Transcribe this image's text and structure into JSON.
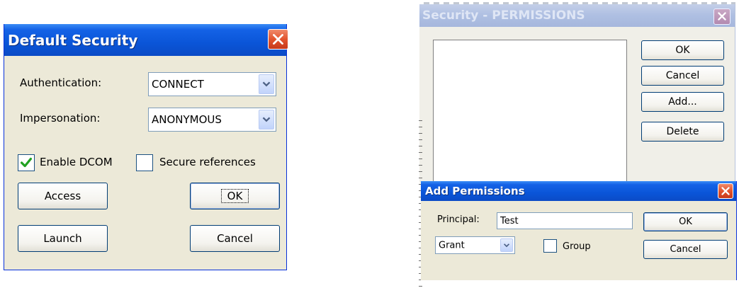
{
  "default_security": {
    "title": "Default Security",
    "authentication_label": "Authentication:",
    "authentication_value": "CONNECT",
    "impersonation_label": "Impersonation:",
    "impersonation_value": "ANONYMOUS",
    "enable_dcom_label": "Enable DCOM",
    "enable_dcom_checked": true,
    "secure_references_label": "Secure references",
    "secure_references_checked": false,
    "access_label": "Access",
    "ok_label": "OK",
    "launch_label": "Launch",
    "cancel_label": "Cancel"
  },
  "security_permissions": {
    "title": "Security - PERMISSIONS",
    "ok_label": "OK",
    "cancel_label": "Cancel",
    "add_label": "Add...",
    "delete_label": "Delete",
    "list_items": []
  },
  "add_permissions": {
    "title": "Add Permissions",
    "principal_label": "Principal:",
    "principal_value": "Test",
    "grant_value": "Grant",
    "group_label": "Group",
    "group_checked": false,
    "ok_label": "OK",
    "cancel_label": "Cancel"
  },
  "colors": {
    "titlebar_blue": "#0a55d8",
    "dialog_face": "#ece9d8",
    "close_red": "#e2542e",
    "check_green": "#21a121"
  }
}
